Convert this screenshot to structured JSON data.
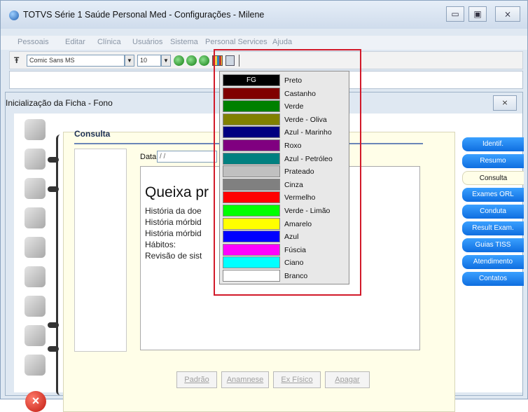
{
  "window": {
    "title": "TOTVS Série 1 Saúde Personal Med - Configurações - Milene",
    "minimize": "▭",
    "maximize": "▣",
    "close": "⨯"
  },
  "menu": [
    "Pessoais",
    "Editar",
    "Clínica",
    "Usuários",
    "Sistema",
    "Personal Services",
    "Ajuda"
  ],
  "toolbar": {
    "font_family": "Comic Sans MS",
    "font_size": "10"
  },
  "child_window": {
    "title": "Inicialização da Ficha - Fono",
    "close": "⨯"
  },
  "consulta": {
    "title": "Consulta",
    "data_label": "Data",
    "data_value": "/ /",
    "memo_heading": "Queixa pr",
    "memo_lines": [
      "História da doe",
      "História mórbid",
      "História mórbid",
      "Hábitos:",
      "Revisão de sist"
    ]
  },
  "actions": [
    "Padrão",
    "Anamnese",
    "Ex Físico",
    "Apagar"
  ],
  "right_tabs": [
    "Identif.",
    "Resumo",
    "Consulta",
    "Exames ORL",
    "Conduta",
    "Result Exam.",
    "Guias TISS",
    "Atendimento",
    "Contatos"
  ],
  "active_tab": "Consulta",
  "color_menu": {
    "fg_label": "FG",
    "items": [
      {
        "name": "Preto",
        "color": "#000000"
      },
      {
        "name": "Castanho",
        "color": "#800000"
      },
      {
        "name": "Verde",
        "color": "#008000"
      },
      {
        "name": "Verde - Oliva",
        "color": "#808000"
      },
      {
        "name": "Azul - Marinho",
        "color": "#000080"
      },
      {
        "name": "Roxo",
        "color": "#800080"
      },
      {
        "name": "Azul - Petróleo",
        "color": "#008080"
      },
      {
        "name": "Prateado",
        "color": "#c0c0c0"
      },
      {
        "name": "Cinza",
        "color": "#808080"
      },
      {
        "name": "Vermelho",
        "color": "#ff0000"
      },
      {
        "name": "Verde - Limão",
        "color": "#00ff00"
      },
      {
        "name": "Amarelo",
        "color": "#ffff00"
      },
      {
        "name": "Azul",
        "color": "#0000ff"
      },
      {
        "name": "Fúscia",
        "color": "#ff00ff"
      },
      {
        "name": "Ciano",
        "color": "#00ffff"
      },
      {
        "name": "Branco",
        "color": "#ffffff"
      }
    ]
  },
  "highlight_color": "#d21a2a"
}
